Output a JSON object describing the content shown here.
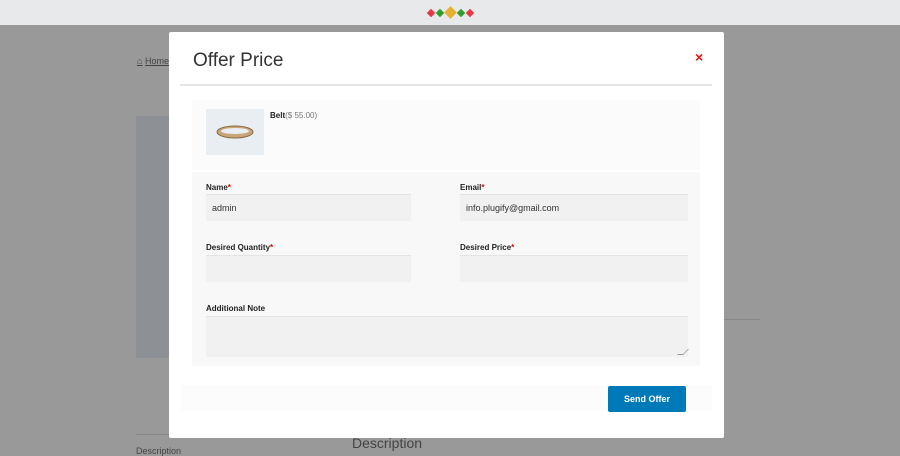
{
  "topbar": {
    "logo_colors": [
      "#e63946",
      "#2ca02c",
      "#e8b030",
      "#2ca02c",
      "#e63946"
    ]
  },
  "background": {
    "breadcrumb": "Home",
    "tab_description": "Description",
    "heading_description": "Description"
  },
  "modal": {
    "title": "Offer Price",
    "close_icon": "×",
    "product": {
      "name": "Belt",
      "price": "($ 55.00)"
    },
    "fields": {
      "name": {
        "label": "Name",
        "required": "*",
        "value": "admin"
      },
      "email": {
        "label": "Email",
        "required": "*",
        "value": "info.plugify@gmail.com"
      },
      "quantity": {
        "label": "Desired Quantity",
        "required": "*",
        "value": ""
      },
      "price": {
        "label": "Desired Price",
        "required": "*",
        "value": ""
      },
      "note": {
        "label": "Additional Note",
        "value": ""
      }
    },
    "submit_label": "Send Offer",
    "accent": "#0079b8"
  }
}
